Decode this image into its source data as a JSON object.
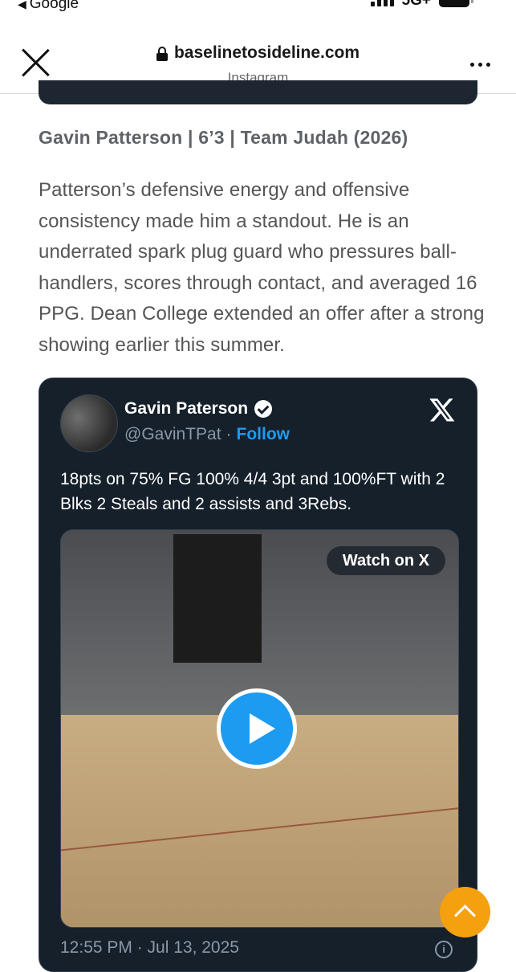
{
  "status_bar": {
    "back_label": "Google",
    "network": "5G+"
  },
  "browser": {
    "domain": "baselinetosideline.com",
    "subtitle": "Instagram"
  },
  "article": {
    "subhead": "Gavin Patterson | 6’3 | Team Judah (2026)",
    "paragraph": "Patterson’s defensive energy and offensive consistency made him a standout. He is an underrated spark plug guard who pressures ball-handlers, scores through contact, and averaged 16 PPG. Dean College extended an offer after a strong showing earlier this summer."
  },
  "tweet": {
    "author_name": "Gavin Paterson",
    "handle": "@GavinTPat",
    "separator": "·",
    "follow_label": "Follow",
    "text": "18pts on 75% FG 100% 4/4 3pt and 100%FT with 2 Blks 2 Steals and 2 assists and 3Rebs.",
    "watch_label": "Watch on X",
    "timestamp": "12:55 PM · Jul 13, 2025",
    "info_glyph": "i"
  },
  "colors": {
    "tweet_bg": "#15202b",
    "link": "#1d9bf0",
    "scroll_button": "#f5a00f"
  },
  "icons": [
    "close-icon",
    "lock-icon",
    "more-icon",
    "verified-icon",
    "x-logo-icon",
    "play-icon",
    "info-icon",
    "chevron-up-icon"
  ]
}
